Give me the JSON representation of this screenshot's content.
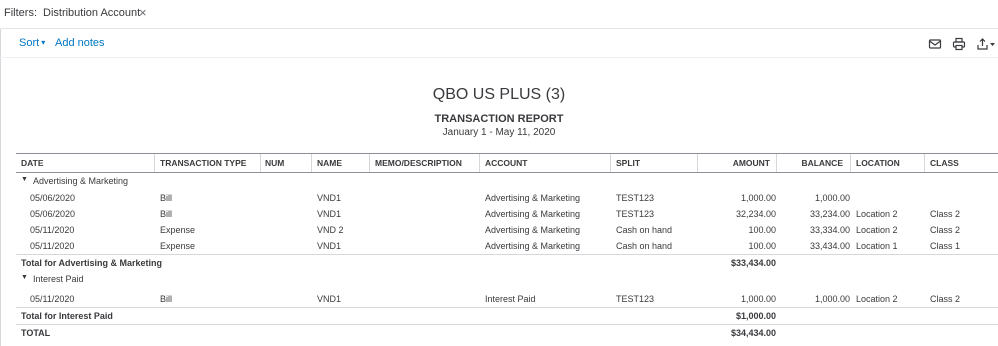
{
  "filters": {
    "label": "Filters:",
    "chip": "Distribution Account",
    "close": "×"
  },
  "toolbar": {
    "sort": "Sort",
    "sort_caret": "▾",
    "add_notes": "Add notes"
  },
  "report": {
    "company": "QBO US PLUS (3)",
    "title": "TRANSACTION REPORT",
    "dates": "January 1 - May 11, 2020"
  },
  "columns": [
    "DATE",
    "TRANSACTION TYPE",
    "NUM",
    "NAME",
    "MEMO/DESCRIPTION",
    "ACCOUNT",
    "SPLIT",
    "AMOUNT",
    "BALANCE",
    "LOCATION",
    "CLASS"
  ],
  "groups": [
    {
      "name": "Advertising & Marketing",
      "rows": [
        {
          "date": "05/06/2020",
          "type": "Bill",
          "num": "",
          "name": "VND1",
          "memo": "",
          "account": "Advertising & Marketing",
          "split": "TEST123",
          "amount": "1,000.00",
          "balance": "1,000.00",
          "location": "",
          "class": ""
        },
        {
          "date": "05/06/2020",
          "type": "Bill",
          "num": "",
          "name": "VND1",
          "memo": "",
          "account": "Advertising & Marketing",
          "split": "TEST123",
          "amount": "32,234.00",
          "balance": "33,234.00",
          "location": "Location 2",
          "class": "Class 2"
        },
        {
          "date": "05/11/2020",
          "type": "Expense",
          "num": "",
          "name": "VND 2",
          "memo": "",
          "account": "Advertising & Marketing",
          "split": "Cash on hand",
          "amount": "100.00",
          "balance": "33,334.00",
          "location": "Location 2",
          "class": "Class 2"
        },
        {
          "date": "05/11/2020",
          "type": "Expense",
          "num": "",
          "name": "VND1",
          "memo": "",
          "account": "Advertising & Marketing",
          "split": "Cash on hand",
          "amount": "100.00",
          "balance": "33,434.00",
          "location": "Location 1",
          "class": "Class 1"
        }
      ],
      "total_label": "Total for Advertising & Marketing",
      "total": "$33,434.00"
    },
    {
      "name": "Interest Paid",
      "rows": [
        {
          "date": "05/11/2020",
          "type": "Bill",
          "num": "",
          "name": "VND1",
          "memo": "",
          "account": "Interest Paid",
          "split": "TEST123",
          "amount": "1,000.00",
          "balance": "1,000.00",
          "location": "Location 2",
          "class": "Class 2"
        }
      ],
      "total_label": "Total for Interest Paid",
      "total": "$1,000.00"
    }
  ],
  "grand_total": {
    "label": "TOTAL",
    "value": "$34,434.00"
  },
  "icons": {
    "email": "email-icon",
    "print": "print-icon",
    "export": "export-icon"
  }
}
